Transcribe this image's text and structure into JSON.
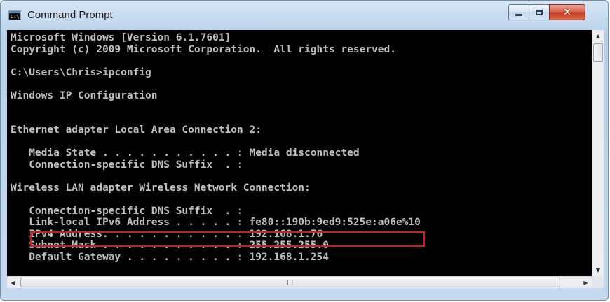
{
  "window": {
    "title": "Command Prompt",
    "icon": "console-icon",
    "icon_glyph": "C:\\",
    "buttons": {
      "close_glyph": "✕"
    }
  },
  "console": {
    "lines": [
      "Microsoft Windows [Version 6.1.7601]",
      "Copyright (c) 2009 Microsoft Corporation.  All rights reserved.",
      "",
      "C:\\Users\\Chris>ipconfig",
      "",
      "Windows IP Configuration",
      "",
      "",
      "Ethernet adapter Local Area Connection 2:",
      "",
      "   Media State . . . . . . . . . . . : Media disconnected",
      "   Connection-specific DNS Suffix  . :",
      "",
      "Wireless LAN adapter Wireless Network Connection:",
      "",
      "   Connection-specific DNS Suffix  . :",
      "   Link-local IPv6 Address . . . . . : fe80::190b:9ed9:525e:a06e%10",
      "   IPv4 Address. . . . . . . . . . . : 192.168.1.76",
      "   Subnet Mask . . . . . . . . . . . : 255.255.255.0",
      "   Default Gateway . . . . . . . . . : 192.168.1.254"
    ],
    "highlighted_line_index": 17,
    "highlight_color": "#e0141c",
    "text_color": "#c0c0c0",
    "background_color": "#000000"
  },
  "scrollbars": {
    "up_arrow": "▲",
    "down_arrow": "▼",
    "left_arrow": "◀",
    "right_arrow": "▶",
    "grip": "III"
  }
}
